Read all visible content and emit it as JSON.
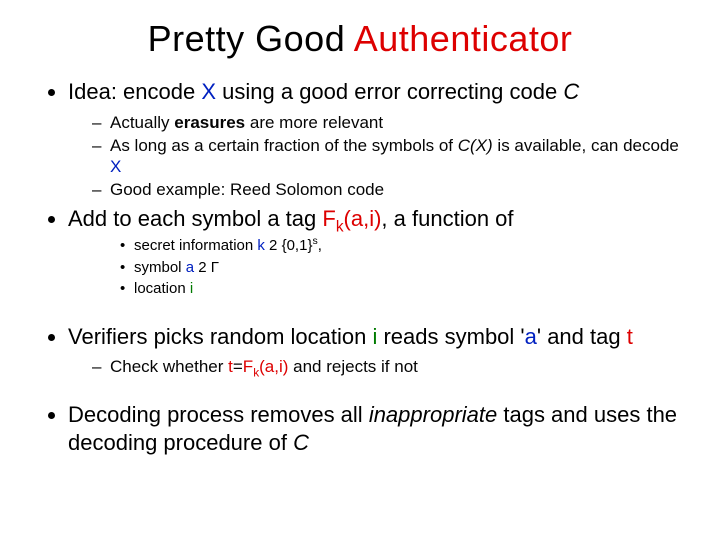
{
  "title": {
    "part1": "Pretty Good ",
    "part2": "Authenticator"
  },
  "bullets": {
    "b1": {
      "pre": "Idea: encode ",
      "x": "X",
      "mid": " using a good error correcting code ",
      "c": "C"
    },
    "b1sub": {
      "s1_pre": "Actually ",
      "s1_bold": "erasures",
      "s1_post": " are more relevant",
      "s2_pre": "As long as a certain fraction of the symbols of ",
      "s2_cx": "C(X)",
      "s2_mid": " is available, can decode ",
      "s2_x": "X",
      "s3": "Good example: Reed Solomon code"
    },
    "b2": {
      "pre": "Add to each symbol a tag ",
      "fk": "F",
      "fk_sub": "k",
      "args": "(a,i)",
      "post": ", a function of"
    },
    "b2sub": {
      "s1_pre": "secret information ",
      "s1_k": "k",
      "s1_in": " 2 ",
      "s1_set": "{0,1}",
      "s1_sup": "s",
      "s1_comma": ",",
      "s2_pre": "symbol ",
      "s2_a": "a",
      "s2_in": " 2 ",
      "s2_gamma": "Γ",
      "s3_pre": " location ",
      "s3_i": "i"
    },
    "b3": {
      "pre": "Verifiers picks random location ",
      "i": "i",
      "mid1": " reads symbol ",
      "q1": "'",
      "a": "a",
      "q2": "'",
      "mid2": " and tag ",
      "t": "t"
    },
    "b3sub": {
      "s1_pre": "Check whether ",
      "s1_t": "t",
      "s1_eq": "=",
      "s1_f": "F",
      "s1_fk": "k",
      "s1_args": "(a,i)",
      "s1_post": " and rejects if not"
    },
    "b4": {
      "pre": "Decoding process removes all ",
      "inapp": "inappropriate",
      "mid": " tags and uses the decoding procedure of ",
      "c": "C"
    }
  }
}
